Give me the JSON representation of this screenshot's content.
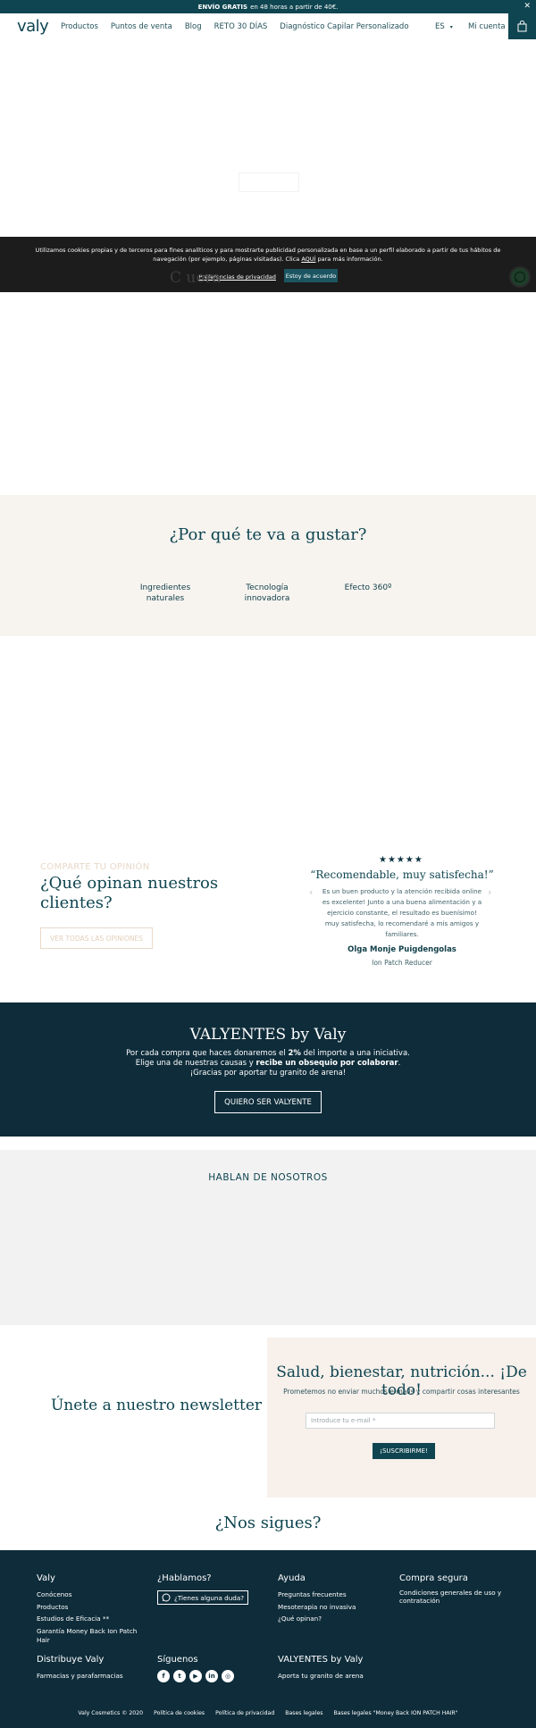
{
  "promo": {
    "bold": "ENVÍO GRATIS",
    "rest": "en 48 horas a partir de 40€.",
    "close": "✕"
  },
  "header": {
    "logo": "valy",
    "nav": [
      "Productos",
      "Puntos de venta",
      "Blog",
      "RETO 30 DÍAS",
      "Diagnóstico Capilar Personalizado"
    ],
    "lang": "ES",
    "lang_caret": "▾",
    "account": "Mi cuenta"
  },
  "cookie": {
    "text1": "Utilizamos cookies propias y de terceros para fines analíticos y para mostrarte publicidad personalizada en base a un perfil elaborado a partir de tus hábitos de navegación (por ejemplo, páginas visitadas). Clica ",
    "link": "AQUÍ",
    "text2": " para más información.",
    "prefs": "Preferencias de privacidad",
    "agree": "Estoy de acuerdo"
  },
  "behind_title": "C                          uera",
  "why": {
    "title": "¿Por qué te va a gustar?",
    "features": [
      "Ingredientes naturales",
      "Tecnología innovadora",
      "Efecto 360º"
    ]
  },
  "reviews": {
    "kicker": "COMPARTE TU OPINIÓN",
    "title": "¿Qué opinan nuestros clientes?",
    "button": "VER TODAS LAS OPINIONES",
    "stars": "★★★★★",
    "rating": 5,
    "headline": "“Recomendable, muy satisfecha!”",
    "body": "Es un buen producto y la atención recibida online es excelente! Junto a una buena alimentación y a ejercicio constante, el resultado es buenísimo! muy satisfecha, lo recomendaré a mis amigos y familiares.",
    "name": "Olga Monje Puigdengolas",
    "product": "Ion Patch Reducer",
    "prev": "‹",
    "next": "›"
  },
  "valyentes": {
    "title": "VALYENTES by Valy",
    "line1a": "Por cada compra que haces donaremos el ",
    "line1b": "2%",
    "line1c": " del importe a una iniciativa.",
    "line2a": "Elige una de nuestras causas y ",
    "line2b": "recibe un obsequio por colaborar",
    "line2c": ".",
    "line3": "¡Gracias por aportar tu granito de arena!",
    "button": "QUIERO SER VALYENTE"
  },
  "press": {
    "title": "HABLAN DE NOSOTROS"
  },
  "newsletter": {
    "left_title": "Únete a nuestro newsletter",
    "right_title": "Salud, bienestar, nutrición... ¡De todo!",
    "sub": "Prometemos no enviar muchos e-mails y compartir cosas interesantes",
    "placeholder": "Introduce tu e-mail *",
    "button": "¡SUSCRIBIRME!"
  },
  "follow": "¿Nos sigues?",
  "footer": {
    "valy": {
      "title": "Valy",
      "links": [
        "Conócenos",
        "Productos",
        "Estudios de Eficacia **",
        "Garantía Money Back Ion Patch Hair"
      ]
    },
    "hablamos": {
      "title": "¿Hablamos?",
      "button": "¿Tienes alguna duda?"
    },
    "ayuda": {
      "title": "Ayuda",
      "links": [
        "Preguntas frecuentes",
        "Mesoterapia no invasiva",
        "¿Qué opinan?"
      ]
    },
    "compra": {
      "title": "Compra segura",
      "links": [
        "Condiciones generales de uso y contratación"
      ]
    },
    "distribuye": {
      "title": "Distribuye Valy",
      "links": [
        "Farmacias y parafarmacias"
      ]
    },
    "siguenos": {
      "title": "Síguenos",
      "icons": [
        "facebook-icon",
        "twitter-icon",
        "youtube-icon",
        "linkedin-icon",
        "instagram-icon"
      ]
    },
    "valyentes": {
      "title": "VALYENTES by Valy",
      "links": [
        "Aporta tu granito de arena"
      ]
    },
    "bottom": [
      "Valy Cosmetics © 2020",
      "Política de cookies",
      "Política de privacidad",
      "Bases legales",
      "Bases legales \"Money Back ION PATCH HAIR\""
    ]
  },
  "colors": {
    "primary": "#0f4550",
    "dark": "#0e2c3a",
    "cream": "#f7f4f0",
    "peach": "#f7f0eb"
  }
}
